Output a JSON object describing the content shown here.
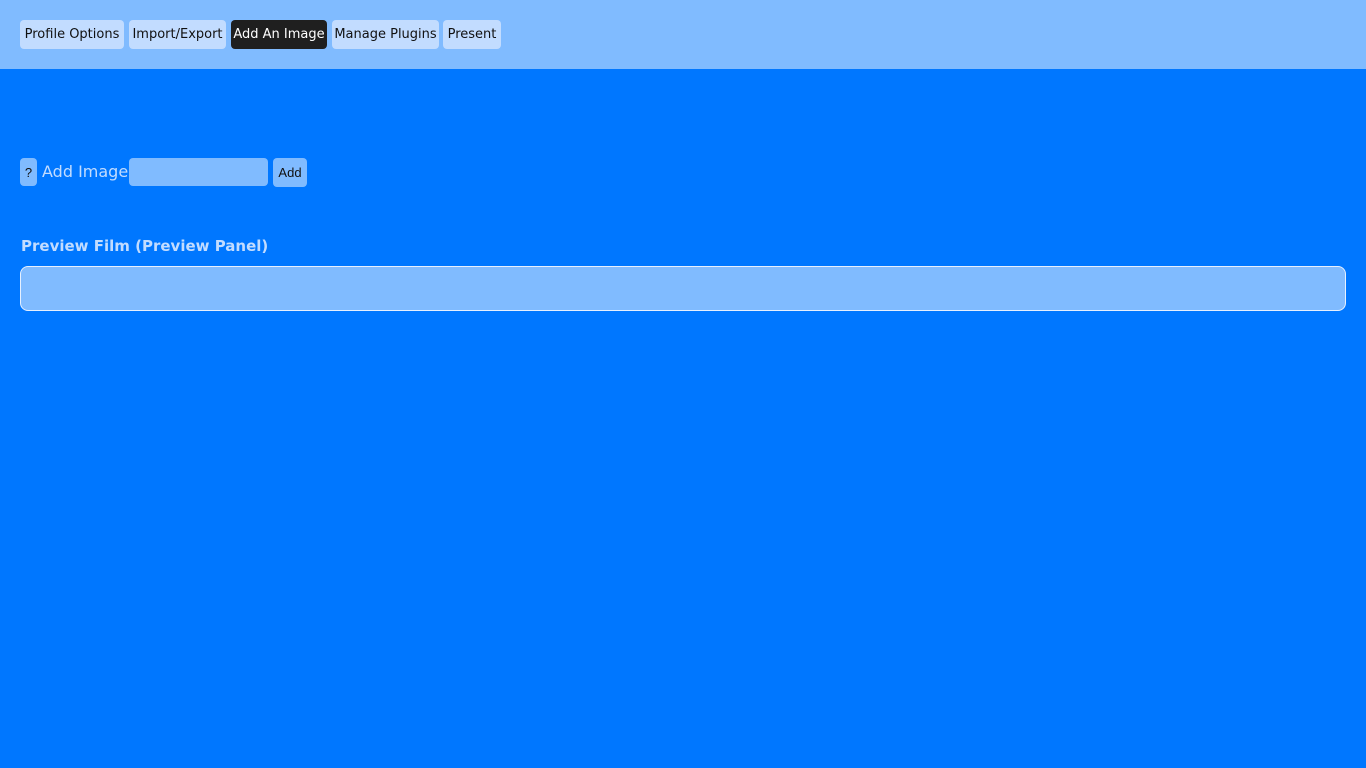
{
  "nav": {
    "tabs": [
      {
        "label": "Profile Options",
        "active": false
      },
      {
        "label": "Import/Export",
        "active": false
      },
      {
        "label": "Add An Image",
        "active": true
      },
      {
        "label": "Manage Plugins",
        "active": false
      },
      {
        "label": "Present",
        "active": false
      }
    ]
  },
  "add_image": {
    "help_label": "?",
    "label": "Add Image:",
    "input_value": "",
    "add_button_label": "Add"
  },
  "preview": {
    "title": "Preview Film (Preview Panel)"
  },
  "colors": {
    "background": "#0077ff",
    "topbar": "#80bbff",
    "tab": "#c2dcff",
    "active_tab": "#1f1f1f",
    "panel": "#80bbff"
  }
}
